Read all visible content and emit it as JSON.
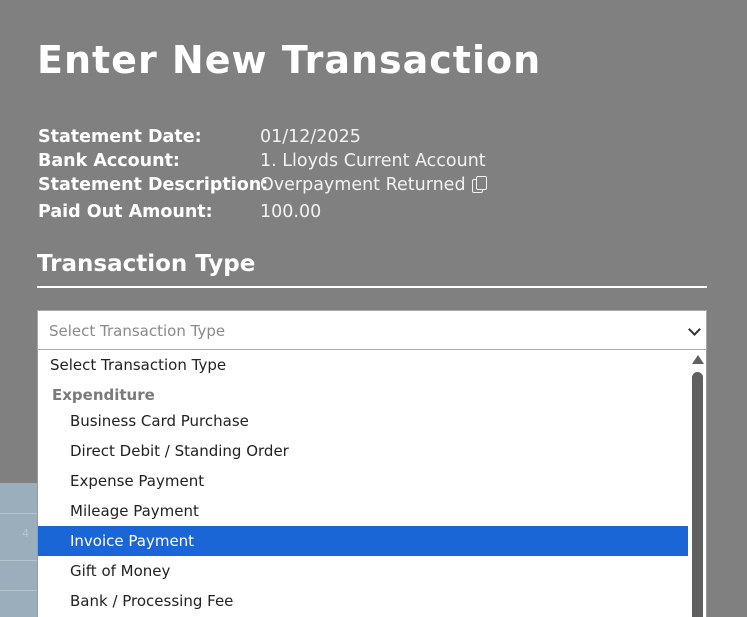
{
  "modal": {
    "title": "Enter New Transaction",
    "details": [
      {
        "label": "Statement Date:",
        "value": "01/12/2025"
      },
      {
        "label": "Bank Account:",
        "value": "1. Lloyds Current Account"
      },
      {
        "label": "Statement Description:",
        "value": "Overpayment Returned",
        "icon": "copy-icon"
      },
      {
        "label": "Paid Out Amount:",
        "value": "100.00"
      }
    ],
    "section_title": "Transaction Type",
    "select": {
      "placeholder": "Select Transaction Type",
      "icon": "chevron-down-icon"
    },
    "dropdown": {
      "top_option": "Select Transaction Type",
      "group_label": "Expenditure",
      "options": [
        "Business Card Purchase",
        "Direct Debit / Standing Order",
        "Expense Payment",
        "Mileage Payment",
        "Invoice Payment",
        "Gift of Money",
        "Bank / Processing Fee"
      ],
      "selected": "Invoice Payment",
      "highlight_color": "#1a66d6"
    }
  },
  "background": {
    "partial_digit": "4"
  },
  "colors": {
    "modal_bg": "#808080",
    "text": "#ffffff"
  }
}
